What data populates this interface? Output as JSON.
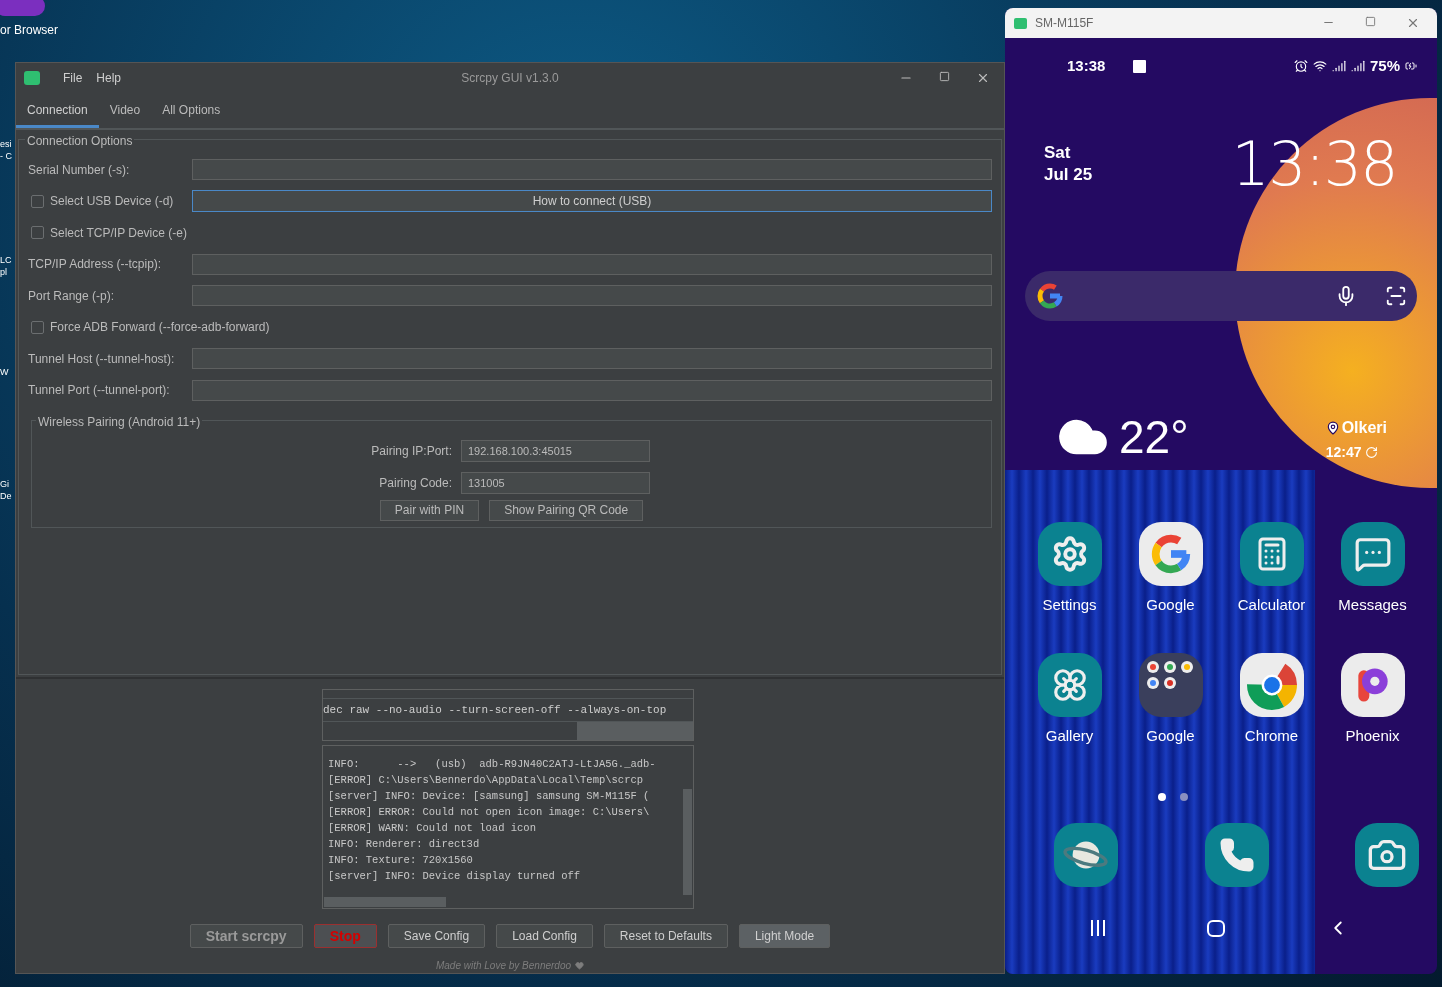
{
  "desktop": {
    "icons": [
      {
        "label": "or Browser"
      }
    ],
    "edge_labels": [
      "esi",
      "- C",
      "LC",
      "pl",
      "W",
      "Gi",
      "De"
    ]
  },
  "app": {
    "title": "Scrcpy GUI v1.3.0",
    "menu": [
      "File",
      "Help"
    ],
    "tabs": [
      {
        "label": "Connection",
        "selected": true
      },
      {
        "label": "Video",
        "selected": false
      },
      {
        "label": "All Options",
        "selected": false
      }
    ],
    "connection_options": {
      "title": "Connection Options",
      "rows": [
        {
          "kind": "field",
          "label": "Serial Number (-s):"
        },
        {
          "kind": "checkbox",
          "label": "Select USB Device (-d)",
          "checked": false,
          "button": "How to connect (USB)"
        },
        {
          "kind": "checkbox",
          "label": "Select TCP/IP Device (-e)",
          "checked": false
        },
        {
          "kind": "field",
          "label": "TCP/IP Address (--tcpip):"
        },
        {
          "kind": "field",
          "label": "Port Range (-p):"
        },
        {
          "kind": "checkbox",
          "label": "Force ADB Forward (--force-adb-forward)",
          "checked": false
        },
        {
          "kind": "field",
          "label": "Tunnel Host (--tunnel-host):"
        },
        {
          "kind": "field",
          "label": "Tunnel Port (--tunnel-port):"
        }
      ]
    },
    "wireless_pairing": {
      "title": "Wireless Pairing (Android 11+)",
      "fields": [
        {
          "label": "Pairing IP:Port:",
          "value": "192.168.100.3:45015"
        },
        {
          "label": "Pairing Code:",
          "value": "131005"
        }
      ],
      "buttons": [
        "Pair with PIN",
        "Show Pairing QR Code"
      ]
    },
    "command_preview": "dec raw --no-audio --turn-screen-off --always-on-top",
    "log_lines": [
      "INFO:      -->   (usb)  adb-R9JN40C2ATJ-LtJA5G._adb-",
      "[ERROR] C:\\Users\\Bennerdo\\AppData\\Local\\Temp\\scrcp",
      "[server] INFO: Device: [samsung] samsung SM-M115F (",
      "[ERROR] ERROR: Could not open icon image: C:\\Users\\",
      "[ERROR] WARN: Could not load icon",
      "INFO: Renderer: direct3d",
      "INFO: Texture: 720x1560",
      "[server] INFO: Device display turned off"
    ],
    "buttons": [
      {
        "label": "Start scrcpy",
        "kind": "start"
      },
      {
        "label": "Stop",
        "kind": "stop"
      },
      {
        "label": "Save Config",
        "kind": "normal"
      },
      {
        "label": "Load Config",
        "kind": "normal"
      },
      {
        "label": "Reset to Defaults",
        "kind": "normal"
      },
      {
        "label": "Light Mode",
        "kind": "toggle"
      }
    ],
    "footer": "Made with Love by Bennerdoo"
  },
  "phone": {
    "title": "SM-M115F",
    "status_bar": {
      "time": "13:38",
      "battery": "75%"
    },
    "date": [
      "Sat",
      "Jul 25"
    ],
    "clock": "13:38",
    "weather": {
      "temperature": "22°",
      "location": "Olkeri",
      "updated": "12:47"
    },
    "apps": [
      {
        "label": "Settings",
        "kind": "settings"
      },
      {
        "label": "Google",
        "kind": "google"
      },
      {
        "label": "Calculator",
        "kind": "calculator"
      },
      {
        "label": "Messages",
        "kind": "messages"
      },
      {
        "label": "Gallery",
        "kind": "gallery"
      },
      {
        "label": "Google",
        "kind": "folder"
      },
      {
        "label": "Chrome",
        "kind": "chrome"
      },
      {
        "label": "Phoenix",
        "kind": "phoenix"
      }
    ],
    "page_dots": [
      {
        "selected": true
      },
      {
        "selected": false
      }
    ],
    "dock": [
      {
        "kind": "internet"
      },
      {
        "kind": "phone"
      },
      {
        "kind": "camera"
      }
    ]
  }
}
